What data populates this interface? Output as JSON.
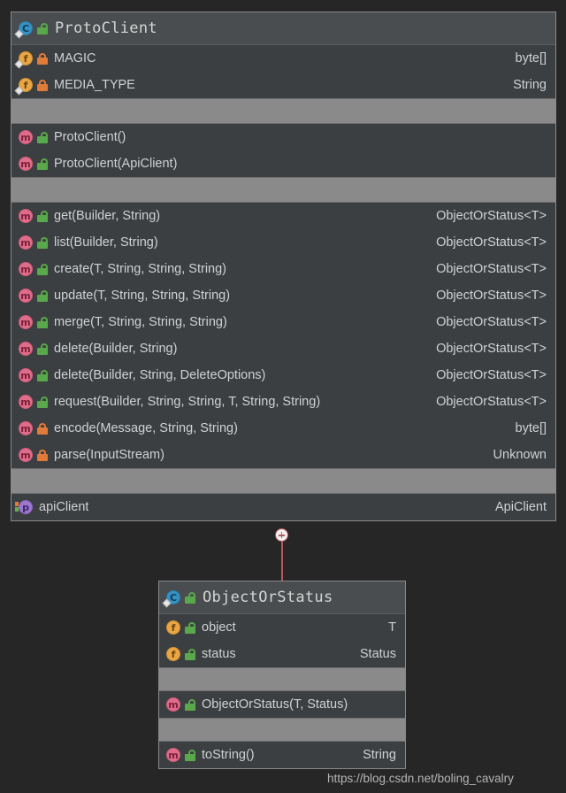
{
  "canvas": {
    "background": "#262626",
    "watermark": "https://blog.csdn.net/boling_cavalry"
  },
  "colors": {
    "box_background": "#3c3f41",
    "header_background": "#4a4d4f",
    "separator_band": "#8a8a8a",
    "text": "#cfd2d4",
    "border": "#5c5f61",
    "connector": "#b6575f",
    "class_icon": "#3592c4",
    "field_icon": "#eaa545",
    "method_icon": "#e06c8b",
    "property_icon": "#9b77cf",
    "lock_public": "#59a84b",
    "lock_private": "#e07b39"
  },
  "classes": [
    {
      "id": "proto-client",
      "name": "ProtoClient",
      "icon": "class-icon",
      "visibility_icon": "unlocked-green-icon",
      "sections": [
        {
          "kind": "fields",
          "members": [
            {
              "icon": "field-icon",
              "lock": "locked-orange-icon",
              "name": "MAGIC",
              "type": "byte[]"
            },
            {
              "icon": "field-icon",
              "lock": "locked-orange-icon",
              "name": "MEDIA_TYPE",
              "type": "String"
            }
          ]
        },
        {
          "kind": "constructors",
          "members": [
            {
              "icon": "method-icon",
              "lock": "unlocked-green-icon",
              "name": "ProtoClient()",
              "type": ""
            },
            {
              "icon": "method-icon",
              "lock": "unlocked-green-icon",
              "name": "ProtoClient(ApiClient)",
              "type": ""
            }
          ]
        },
        {
          "kind": "methods",
          "members": [
            {
              "icon": "method-icon",
              "lock": "unlocked-green-icon",
              "name": "get(Builder, String)",
              "type": "ObjectOrStatus<T>"
            },
            {
              "icon": "method-icon",
              "lock": "unlocked-green-icon",
              "name": "list(Builder, String)",
              "type": "ObjectOrStatus<T>"
            },
            {
              "icon": "method-icon",
              "lock": "unlocked-green-icon",
              "name": "create(T, String, String, String)",
              "type": "ObjectOrStatus<T>"
            },
            {
              "icon": "method-icon",
              "lock": "unlocked-green-icon",
              "name": "update(T, String, String, String)",
              "type": "ObjectOrStatus<T>"
            },
            {
              "icon": "method-icon",
              "lock": "unlocked-green-icon",
              "name": "merge(T, String, String, String)",
              "type": "ObjectOrStatus<T>"
            },
            {
              "icon": "method-icon",
              "lock": "unlocked-green-icon",
              "name": "delete(Builder, String)",
              "type": "ObjectOrStatus<T>"
            },
            {
              "icon": "method-icon",
              "lock": "unlocked-green-icon",
              "name": "delete(Builder, String, DeleteOptions)",
              "type": "ObjectOrStatus<T>"
            },
            {
              "icon": "method-icon",
              "lock": "unlocked-green-icon",
              "name": "request(Builder, String, String, T, String, String)",
              "type": "ObjectOrStatus<T>"
            },
            {
              "icon": "method-icon",
              "lock": "locked-orange-icon",
              "name": "encode(Message, String, String)",
              "type": "byte[]"
            },
            {
              "icon": "method-icon",
              "lock": "locked-orange-icon",
              "name": "parse(InputStream)",
              "type": "Unknown"
            }
          ]
        },
        {
          "kind": "properties",
          "members": [
            {
              "icon": "property-icon",
              "lock": "",
              "name": "apiClient",
              "type": "ApiClient"
            }
          ]
        }
      ]
    },
    {
      "id": "object-or-status",
      "name": "ObjectOrStatus",
      "icon": "class-icon",
      "visibility_icon": "unlocked-green-icon",
      "sections": [
        {
          "kind": "fields",
          "members": [
            {
              "icon": "field-icon",
              "lock": "unlocked-green-icon",
              "name": "object",
              "type": "T"
            },
            {
              "icon": "field-icon",
              "lock": "unlocked-green-icon",
              "name": "status",
              "type": "Status"
            }
          ]
        },
        {
          "kind": "constructors",
          "members": [
            {
              "icon": "method-icon",
              "lock": "unlocked-green-icon",
              "name": "ObjectOrStatus(T, Status)",
              "type": ""
            }
          ]
        },
        {
          "kind": "methods",
          "members": [
            {
              "icon": "method-icon",
              "lock": "unlocked-green-icon",
              "name": "toString()",
              "type": "String"
            }
          ]
        }
      ]
    }
  ],
  "connector": {
    "marker": "expand-plus-node",
    "from": "proto-client",
    "to": "object-or-status"
  }
}
